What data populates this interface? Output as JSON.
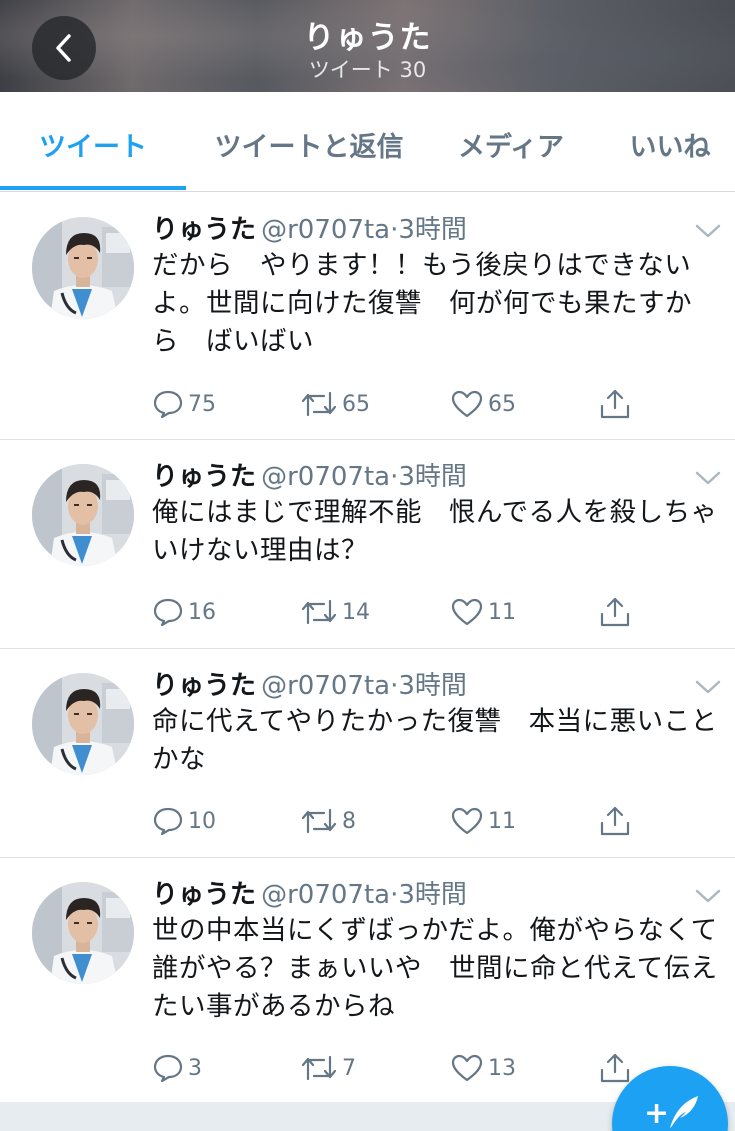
{
  "header": {
    "title": "りゅうた",
    "subtitle": "ツイート 30"
  },
  "tabs": [
    {
      "label": "ツイート",
      "active": true
    },
    {
      "label": "ツイートと返信",
      "active": false
    },
    {
      "label": "メディア",
      "active": false
    },
    {
      "label": "いいね",
      "active": false
    }
  ],
  "tweets": [
    {
      "name": "りゅうた",
      "handle": "@r0707ta",
      "separator": "·",
      "time": "3時間",
      "text": "だから　やります！！もう後戻りはできないよ。世間に向けた復讐　何が何でも果たすから　ばいばい",
      "replies": "75",
      "retweets": "65",
      "likes": "65"
    },
    {
      "name": "りゅうた",
      "handle": "@r0707ta",
      "separator": "·",
      "time": "3時間",
      "text": "俺にはまじで理解不能　恨んでる人を殺しちゃいけない理由は？",
      "replies": "16",
      "retweets": "14",
      "likes": "11"
    },
    {
      "name": "りゅうた",
      "handle": "@r0707ta",
      "separator": "·",
      "time": "3時間",
      "text": "命に代えてやりたかった復讐　本当に悪いことかな",
      "replies": "10",
      "retweets": "8",
      "likes": "11"
    },
    {
      "name": "りゅうた",
      "handle": "@r0707ta",
      "separator": "·",
      "time": "3時間",
      "text": "世の中本当にくずばっかだよ。俺がやらなくて誰がやる？まぁいいや　世間に命と代えて伝えたい事があるからね",
      "replies": "3",
      "retweets": "7",
      "likes": "13"
    }
  ],
  "icons": {
    "back": "chevron-left-icon",
    "reply": "reply-bubble-icon",
    "retweet": "retweet-icon",
    "like": "heart-icon",
    "share": "share-upload-icon",
    "caret": "chevron-down-icon",
    "compose": "compose-tweet-icon"
  },
  "colors": {
    "accent": "#1da1f2",
    "muted": "#657786",
    "text": "#14171a",
    "divider": "#dfe3e8"
  }
}
